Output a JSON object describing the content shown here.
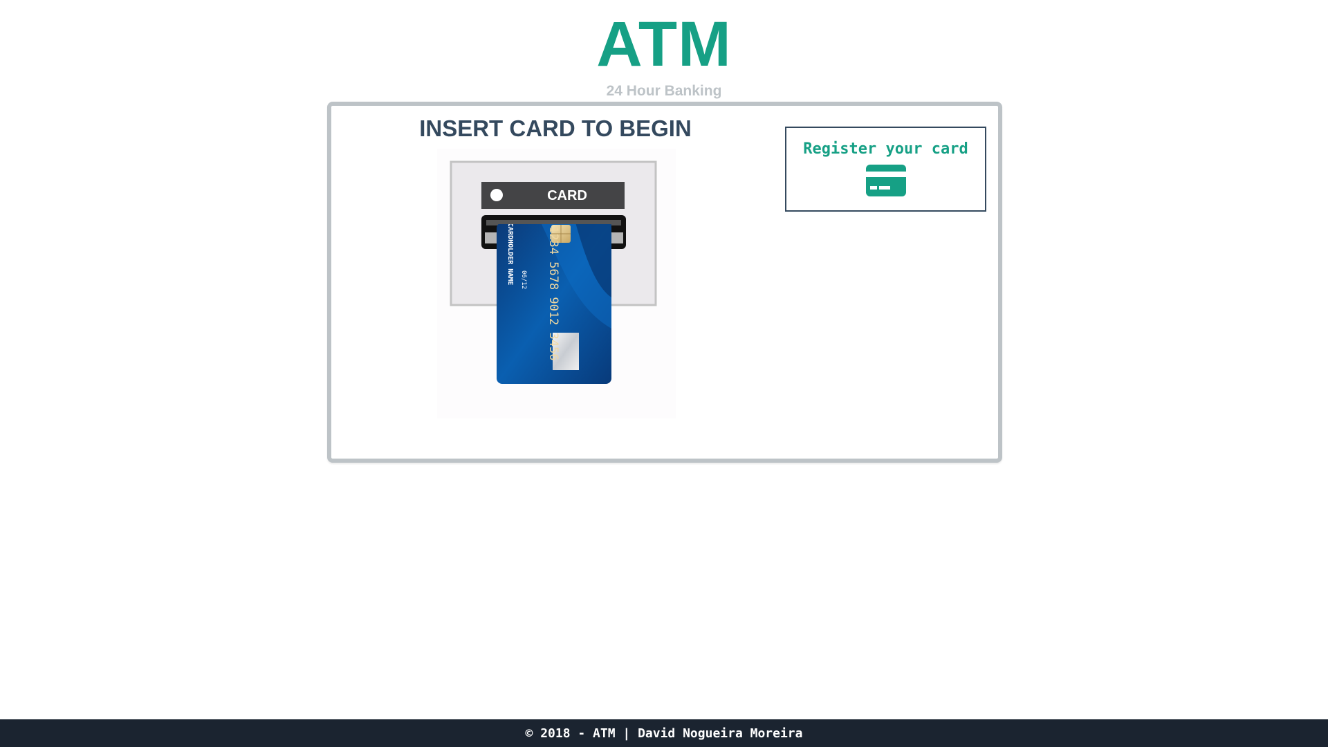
{
  "header": {
    "title": "ATM",
    "subtitle": "24 Hour Banking"
  },
  "main": {
    "instruction": "INSERT CARD TO BEGIN",
    "card_slot_label": "CARD",
    "card_image": {
      "number_text": "1234 5678 9012 3456",
      "holder_text": "CARDHOLDER NAME",
      "expiry_text": "06/12"
    },
    "register": {
      "label": "Register your card",
      "icon": "credit-card-icon"
    }
  },
  "footer": {
    "text": "© 2018 - ATM | David Nogueira Moreira"
  },
  "colors": {
    "brand": "#16a085",
    "heading": "#34495e",
    "subtitle": "#bdc3c7",
    "frame": "#bdc3c7",
    "footer_bg": "#1b2430"
  }
}
